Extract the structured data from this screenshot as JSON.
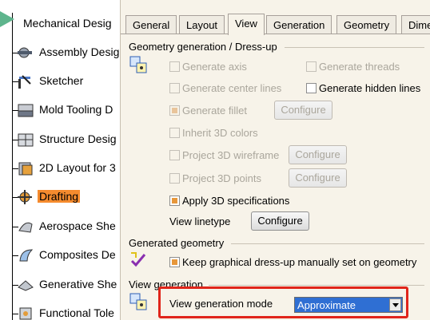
{
  "tree": {
    "root_label": "Mechanical Desig",
    "items": [
      {
        "label": "Assembly Desig",
        "icon": "assembly-icon"
      },
      {
        "label": "Sketcher",
        "icon": "sketcher-icon"
      },
      {
        "label": "Mold Tooling D",
        "icon": "mold-tooling-icon"
      },
      {
        "label": "Structure Desig",
        "icon": "structure-icon"
      },
      {
        "label": "2D Layout for 3",
        "icon": "layout-2d-icon"
      },
      {
        "label": "Drafting",
        "icon": "drafting-icon"
      },
      {
        "label": "Aerospace She",
        "icon": "aerospace-icon"
      },
      {
        "label": "Composites De",
        "icon": "composites-icon"
      },
      {
        "label": "Generative She",
        "icon": "generative-icon"
      },
      {
        "label": "Functional Tole",
        "icon": "functional-tolerancing-icon"
      }
    ]
  },
  "tabs": [
    "General",
    "Layout",
    "View",
    "Generation",
    "Geometry",
    "Dime"
  ],
  "active_tab": "View",
  "geometry_section": {
    "title": "Geometry generation / Dress-up",
    "generate_axis": "Generate axis",
    "generate_threads": "Generate threads",
    "generate_center_lines": "Generate center lines",
    "generate_hidden_lines": "Generate hidden lines",
    "generate_fillet": "Generate fillet",
    "inherit_3d_colors": "Inherit 3D colors",
    "project_3d_wireframe": "Project 3D wireframe",
    "project_3d_points": "Project 3D points",
    "apply_3d_specifications": "Apply 3D specifications",
    "view_linetype": "View linetype",
    "configure": "Configure"
  },
  "generated_section": {
    "title": "Generated geometry",
    "keep_dressup": "Keep graphical dress-up manually set on geometry"
  },
  "view_generation": {
    "title": "View generation",
    "mode_label": "View generation mode",
    "mode_value": "Approximate"
  },
  "colors": {
    "selected_item": "#f58b2e",
    "highlight_box": "#e0251a",
    "checkbox_fill": "#e7973a"
  }
}
